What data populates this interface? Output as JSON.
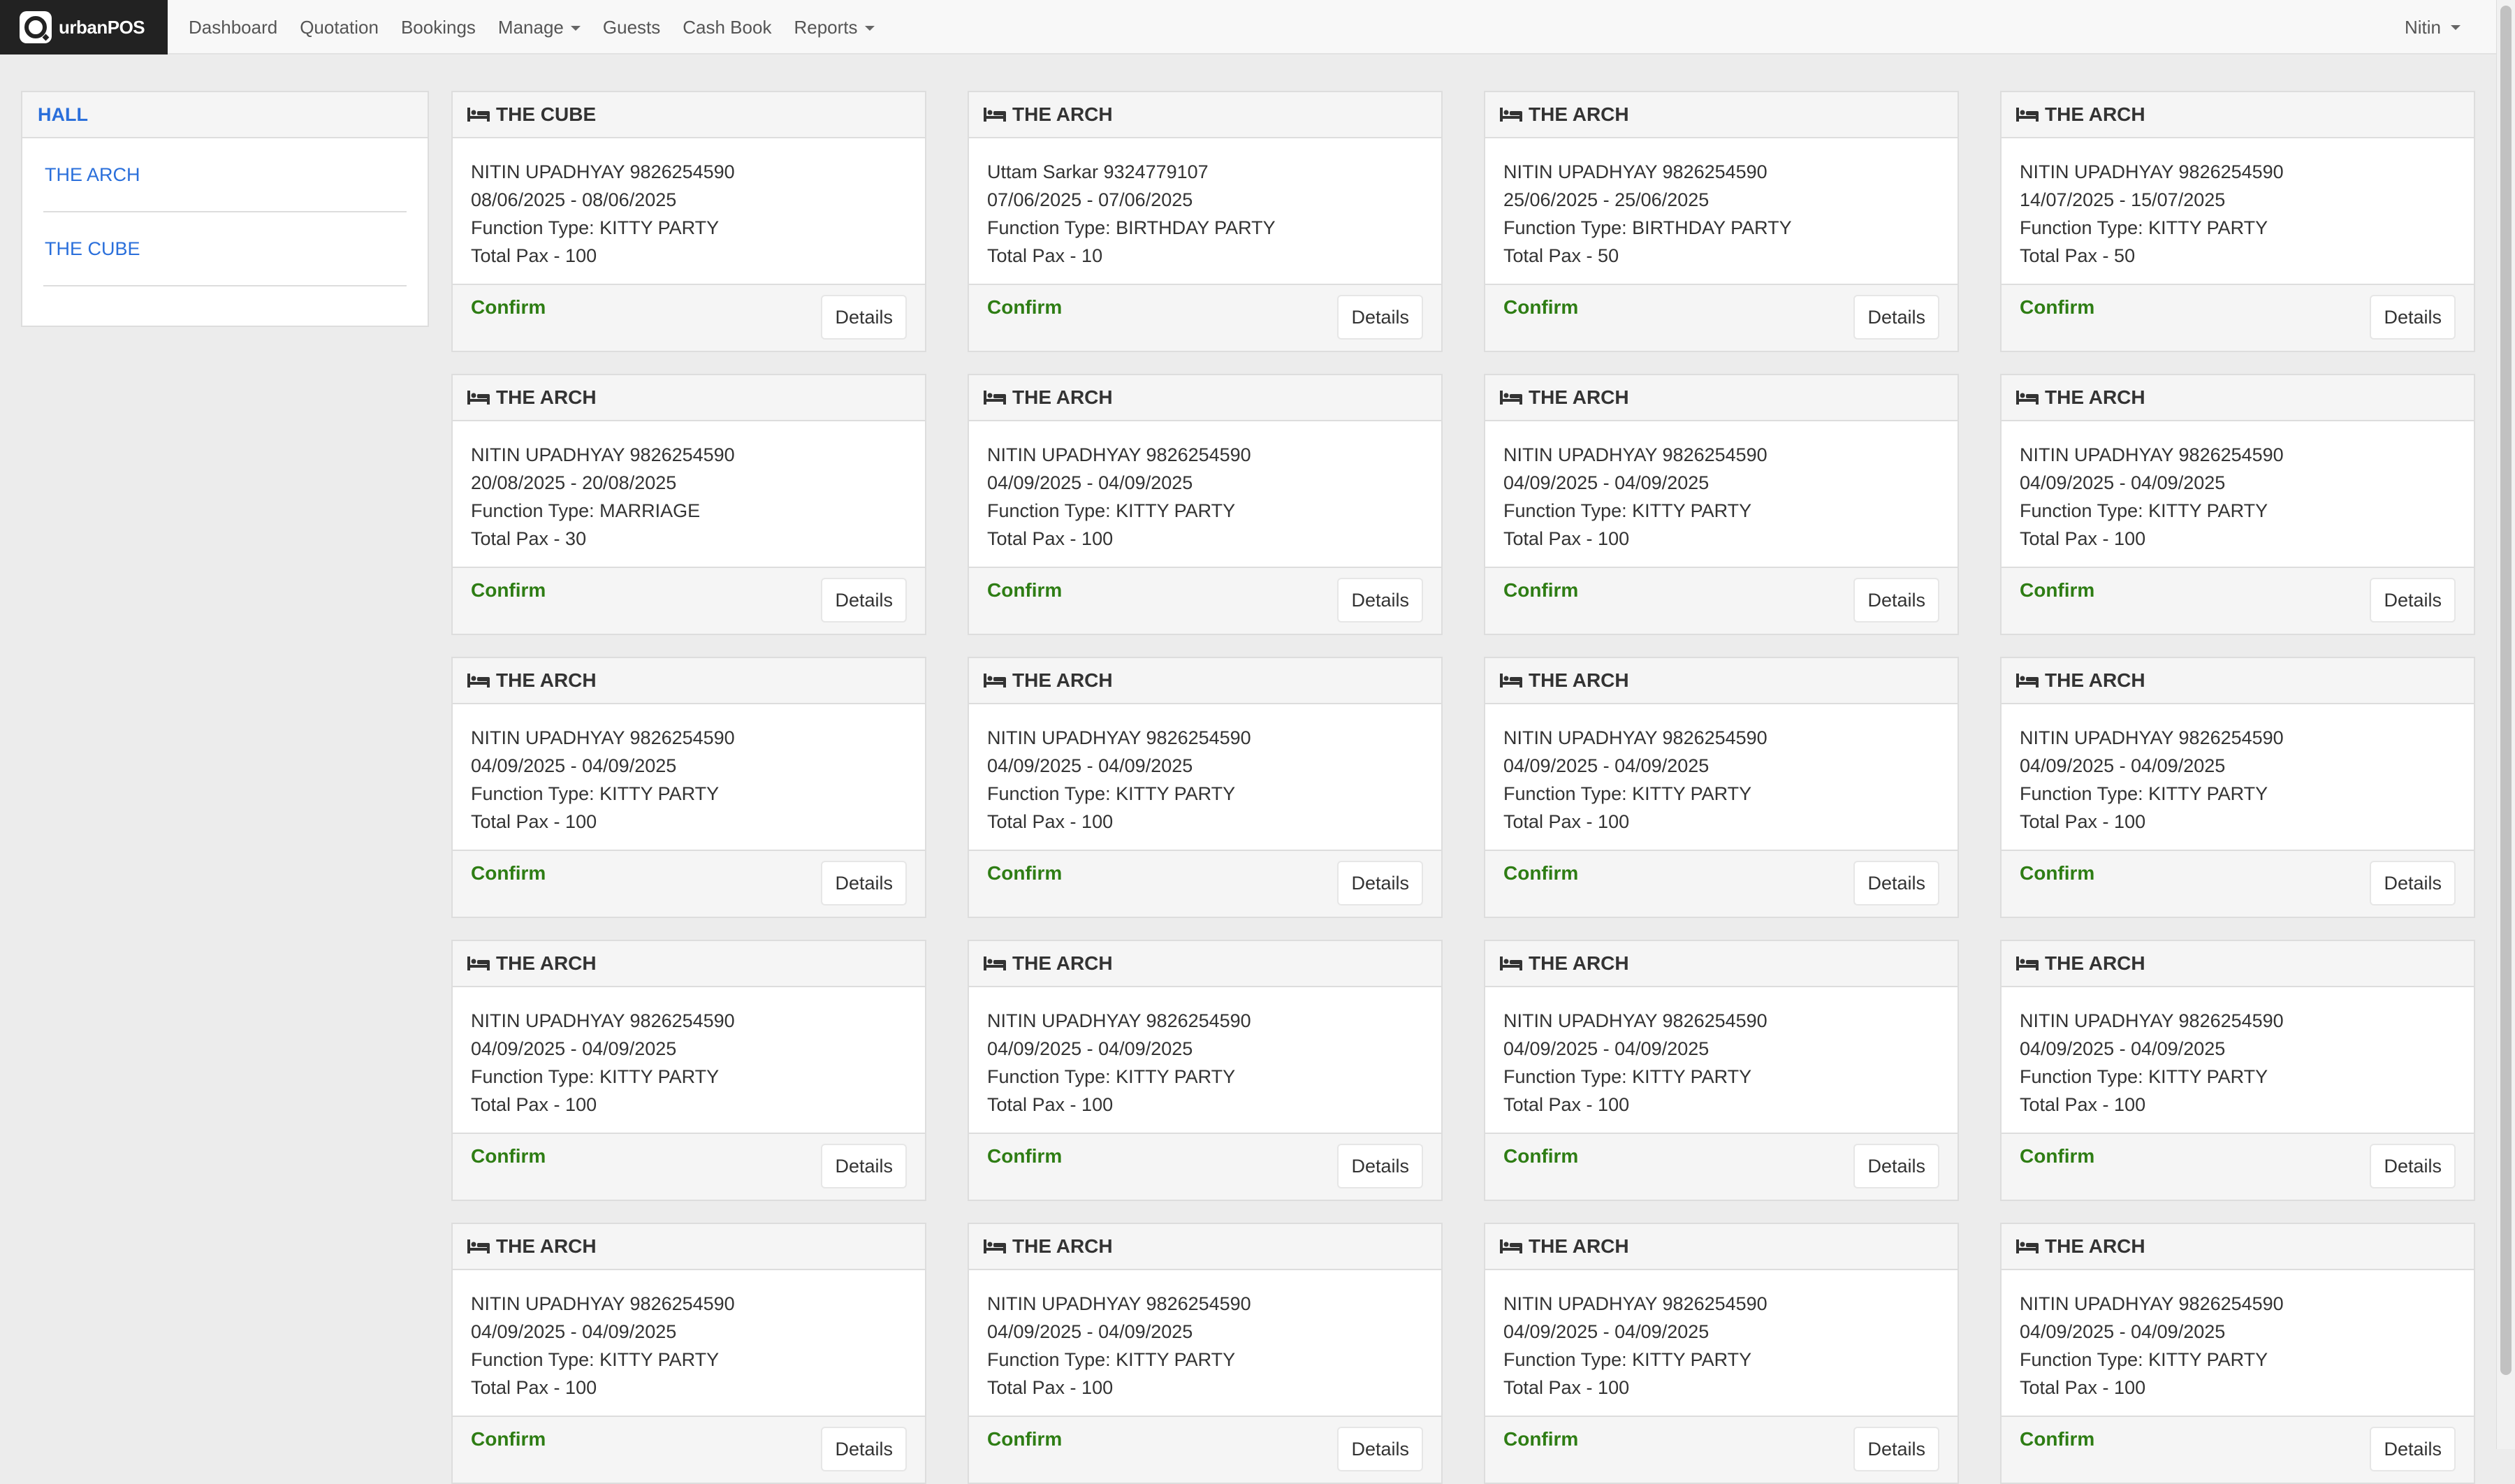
{
  "brand": {
    "name": "urbanPOS"
  },
  "nav": {
    "links": [
      {
        "label": "Dashboard"
      },
      {
        "label": "Quotation"
      },
      {
        "label": "Bookings"
      },
      {
        "label": "Manage",
        "dropdown": true
      },
      {
        "label": "Guests"
      },
      {
        "label": "Cash Book"
      },
      {
        "label": "Reports",
        "dropdown": true
      }
    ],
    "user": "Nitin"
  },
  "sidebar": {
    "title": "HALL",
    "items": [
      {
        "label": "THE ARCH"
      },
      {
        "label": "THE CUBE"
      }
    ]
  },
  "cards": [
    {
      "hall": "THE CUBE",
      "guest": "NITIN UPADHYAY 9826254590",
      "dates": "08/06/2025 - 08/06/2025",
      "function": "Function Type: KITTY PARTY",
      "pax": "Total Pax - 100",
      "status": "Confirm",
      "action": "Details"
    },
    {
      "hall": "THE ARCH",
      "guest": "Uttam Sarkar 9324779107",
      "dates": "07/06/2025 - 07/06/2025",
      "function": "Function Type: BIRTHDAY PARTY",
      "pax": "Total Pax - 10",
      "status": "Confirm",
      "action": "Details"
    },
    {
      "hall": "THE ARCH",
      "guest": "NITIN UPADHYAY 9826254590",
      "dates": "25/06/2025 - 25/06/2025",
      "function": "Function Type: BIRTHDAY PARTY",
      "pax": "Total Pax - 50",
      "status": "Confirm",
      "action": "Details"
    },
    {
      "hall": "THE ARCH",
      "guest": "NITIN UPADHYAY 9826254590",
      "dates": "14/07/2025 - 15/07/2025",
      "function": "Function Type: KITTY PARTY",
      "pax": "Total Pax - 50",
      "status": "Confirm",
      "action": "Details"
    },
    {
      "hall": "THE ARCH",
      "guest": "NITIN UPADHYAY 9826254590",
      "dates": "20/08/2025 - 20/08/2025",
      "function": "Function Type: MARRIAGE",
      "pax": "Total Pax - 30",
      "status": "Confirm",
      "action": "Details"
    },
    {
      "hall": "THE ARCH",
      "guest": "NITIN UPADHYAY 9826254590",
      "dates": "04/09/2025 - 04/09/2025",
      "function": "Function Type: KITTY PARTY",
      "pax": "Total Pax - 100",
      "status": "Confirm",
      "action": "Details"
    },
    {
      "hall": "THE ARCH",
      "guest": "NITIN UPADHYAY 9826254590",
      "dates": "04/09/2025 - 04/09/2025",
      "function": "Function Type: KITTY PARTY",
      "pax": "Total Pax - 100",
      "status": "Confirm",
      "action": "Details"
    },
    {
      "hall": "THE ARCH",
      "guest": "NITIN UPADHYAY 9826254590",
      "dates": "04/09/2025 - 04/09/2025",
      "function": "Function Type: KITTY PARTY",
      "pax": "Total Pax - 100",
      "status": "Confirm",
      "action": "Details"
    },
    {
      "hall": "THE ARCH",
      "guest": "NITIN UPADHYAY 9826254590",
      "dates": "04/09/2025 - 04/09/2025",
      "function": "Function Type: KITTY PARTY",
      "pax": "Total Pax - 100",
      "status": "Confirm",
      "action": "Details"
    },
    {
      "hall": "THE ARCH",
      "guest": "NITIN UPADHYAY 9826254590",
      "dates": "04/09/2025 - 04/09/2025",
      "function": "Function Type: KITTY PARTY",
      "pax": "Total Pax - 100",
      "status": "Confirm",
      "action": "Details"
    },
    {
      "hall": "THE ARCH",
      "guest": "NITIN UPADHYAY 9826254590",
      "dates": "04/09/2025 - 04/09/2025",
      "function": "Function Type: KITTY PARTY",
      "pax": "Total Pax - 100",
      "status": "Confirm",
      "action": "Details"
    },
    {
      "hall": "THE ARCH",
      "guest": "NITIN UPADHYAY 9826254590",
      "dates": "04/09/2025 - 04/09/2025",
      "function": "Function Type: KITTY PARTY",
      "pax": "Total Pax - 100",
      "status": "Confirm",
      "action": "Details"
    },
    {
      "hall": "THE ARCH",
      "guest": "NITIN UPADHYAY 9826254590",
      "dates": "04/09/2025 - 04/09/2025",
      "function": "Function Type: KITTY PARTY",
      "pax": "Total Pax - 100",
      "status": "Confirm",
      "action": "Details"
    },
    {
      "hall": "THE ARCH",
      "guest": "NITIN UPADHYAY 9826254590",
      "dates": "04/09/2025 - 04/09/2025",
      "function": "Function Type: KITTY PARTY",
      "pax": "Total Pax - 100",
      "status": "Confirm",
      "action": "Details"
    },
    {
      "hall": "THE ARCH",
      "guest": "NITIN UPADHYAY 9826254590",
      "dates": "04/09/2025 - 04/09/2025",
      "function": "Function Type: KITTY PARTY",
      "pax": "Total Pax - 100",
      "status": "Confirm",
      "action": "Details"
    },
    {
      "hall": "THE ARCH",
      "guest": "NITIN UPADHYAY 9826254590",
      "dates": "04/09/2025 - 04/09/2025",
      "function": "Function Type: KITTY PARTY",
      "pax": "Total Pax - 100",
      "status": "Confirm",
      "action": "Details"
    },
    {
      "hall": "THE ARCH",
      "guest": "NITIN UPADHYAY 9826254590",
      "dates": "04/09/2025 - 04/09/2025",
      "function": "Function Type: KITTY PARTY",
      "pax": "Total Pax - 100",
      "status": "Confirm",
      "action": "Details"
    },
    {
      "hall": "THE ARCH",
      "guest": "NITIN UPADHYAY 9826254590",
      "dates": "04/09/2025 - 04/09/2025",
      "function": "Function Type: KITTY PARTY",
      "pax": "Total Pax - 100",
      "status": "Confirm",
      "action": "Details"
    },
    {
      "hall": "THE ARCH",
      "guest": "NITIN UPADHYAY 9826254590",
      "dates": "04/09/2025 - 04/09/2025",
      "function": "Function Type: KITTY PARTY",
      "pax": "Total Pax - 100",
      "status": "Confirm",
      "action": "Details"
    },
    {
      "hall": "THE ARCH",
      "guest": "NITIN UPADHYAY 9826254590",
      "dates": "04/09/2025 - 04/09/2025",
      "function": "Function Type: KITTY PARTY",
      "pax": "Total Pax - 100",
      "status": "Confirm",
      "action": "Details"
    }
  ],
  "colors": {
    "brand_bg": "#222222",
    "link": "#2a6fdb",
    "confirm": "#2e7d14",
    "page_bg": "#ececec"
  },
  "icons": {
    "card_icon": "bed-icon",
    "brand_icon": "urbanpos-logo-icon",
    "dropdown_icon": "caret-down-icon"
  }
}
